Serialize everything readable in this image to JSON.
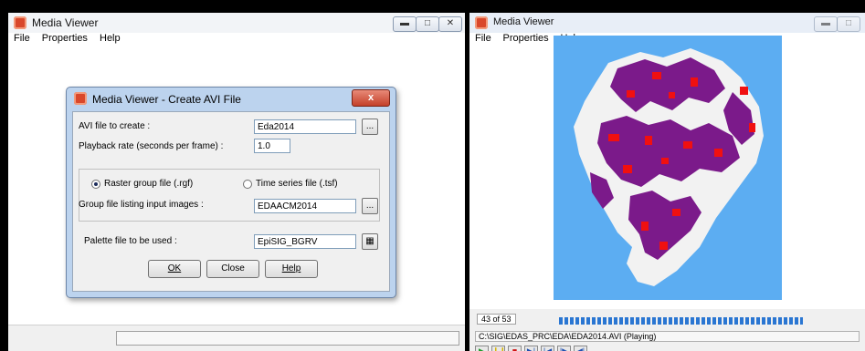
{
  "left_window": {
    "title": "Media Viewer",
    "menu": [
      "File",
      "Properties",
      "Help"
    ],
    "caption_buttons": [
      "minimize",
      "maximize",
      "close"
    ]
  },
  "dialog": {
    "title": "Media Viewer - Create AVI File",
    "close_label": "x",
    "avi_label": "AVI file to create :",
    "avi_value": "Eda2014",
    "browse_label": "...",
    "playback_label": "Playback rate (seconds per frame) :",
    "playback_value": "1.0",
    "radio_raster_label": "Raster group file (.rgf)",
    "radio_timeseries_label": "Time series file (.tsf)",
    "selected_radio": "raster",
    "group_label": "Group file listing input images :",
    "group_value": "EDAACM2014",
    "palette_label": "Palette file to be used :",
    "palette_value": "EpiSIG_BGRV",
    "ok_label": "OK",
    "close_button_label": "Close",
    "help_label": "Help"
  },
  "right_window": {
    "title": "Media Viewer",
    "menu": [
      "File",
      "Properties",
      "Help"
    ],
    "frame_counter": "43 of 53",
    "progress_fraction": 0.81,
    "status_path": "C:\\SIG\\EDAS_PRC\\EDA\\EDA2014.AVI (Playing)",
    "playback_controls": [
      "play",
      "pause",
      "stop",
      "step-forward",
      "go-first",
      "go-next",
      "go-back"
    ]
  },
  "colors": {
    "map_water": "#5cadf2",
    "map_region_purple": "#7b1a8a",
    "map_region_red": "#f01010",
    "map_region_white": "#f2f2f2",
    "progress_blue": "#2a76d2"
  }
}
